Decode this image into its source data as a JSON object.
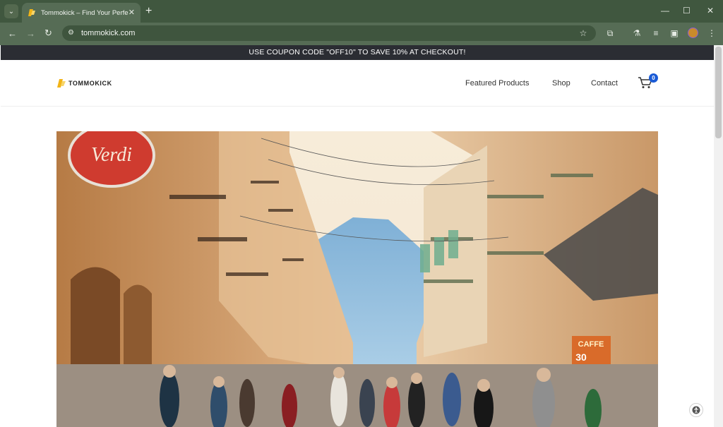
{
  "browser": {
    "tab_title": "Tommokick – Find Your Perfect",
    "tab_close": "✕",
    "new_tab": "+",
    "url": "tommokick.com",
    "icons": [
      "tab-search-icon",
      "back-arrow-icon",
      "forward-arrow-icon",
      "reload-icon",
      "site-info-icon",
      "bookmark-star-icon",
      "extensions-icon",
      "labs-flask-icon",
      "media-queue-icon",
      "sidebar-icon",
      "profile-avatar-icon",
      "kebab-menu-icon",
      "minimize-icon",
      "maximize-icon",
      "close-icon"
    ]
  },
  "announcement": {
    "text": "USE COUPON CODE \"OFF10\" TO SAVE 10% AT CHECKOUT!"
  },
  "header": {
    "logo_text": "TOMMOKICK",
    "nav": [
      "Featured Products",
      "Shop",
      "Contact"
    ],
    "cart_count": "0"
  },
  "hero": {
    "sign_text": "Verdi",
    "shop_sign": "CAFFE",
    "street_number": "30"
  },
  "colors": {
    "chrome_dark": "#40573f",
    "chrome_mid": "#566c55",
    "announce_bg": "#2b2d33",
    "badge": "#1a5bd6"
  }
}
